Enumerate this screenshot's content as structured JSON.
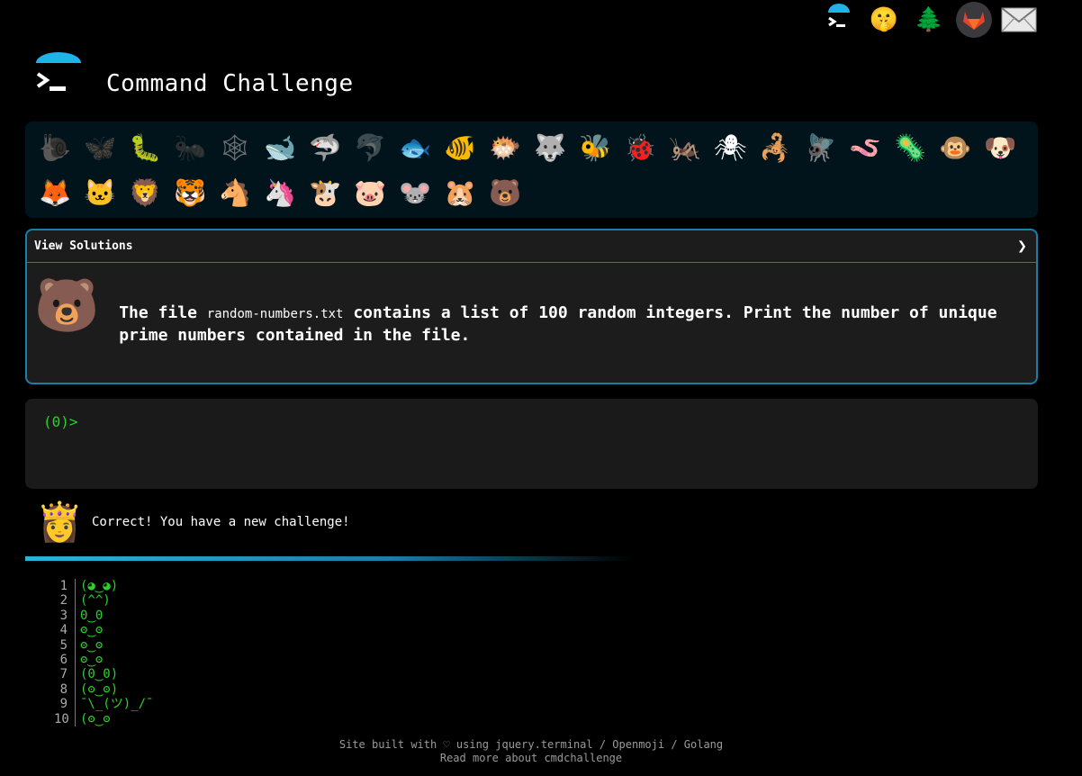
{
  "header": {
    "title": "Command Challenge"
  },
  "top_icons": [
    {
      "name": "cmd-logo-icon",
      "glyph": ""
    },
    {
      "name": "shushing-face-icon",
      "glyph": "🤫"
    },
    {
      "name": "tree-icon",
      "glyph": "🌲"
    },
    {
      "name": "gitlab-icon",
      "glyph": ""
    },
    {
      "name": "mail-icon",
      "glyph": "✉"
    }
  ],
  "animals": [
    {
      "glyph": "🐌",
      "name": "snail",
      "done": false
    },
    {
      "glyph": "🦋",
      "name": "butterfly",
      "done": false
    },
    {
      "glyph": "🐛",
      "name": "caterpillar",
      "done": true
    },
    {
      "glyph": "🐜",
      "name": "ant",
      "done": false
    },
    {
      "glyph": "🕸",
      "name": "spider-web",
      "done": false
    },
    {
      "glyph": "🐋",
      "name": "whale",
      "done": true
    },
    {
      "glyph": "🦈",
      "name": "shark",
      "done": true
    },
    {
      "glyph": "🐬",
      "name": "dolphin",
      "done": false
    },
    {
      "glyph": "🐟",
      "name": "fish",
      "done": true
    },
    {
      "glyph": "🐠",
      "name": "tropical-fish",
      "done": true
    },
    {
      "glyph": "🐡",
      "name": "blowfish",
      "done": true
    },
    {
      "glyph": "🐺",
      "name": "wolf",
      "done": true
    },
    {
      "glyph": "🐝",
      "name": "bee",
      "done": true
    },
    {
      "glyph": "🐞",
      "name": "ladybug",
      "done": true
    },
    {
      "glyph": "🦗",
      "name": "cricket",
      "done": true
    },
    {
      "glyph": "🕷",
      "name": "spider",
      "done": true
    },
    {
      "glyph": "🦂",
      "name": "scorpion",
      "done": true
    },
    {
      "glyph": "🪰",
      "name": "fly",
      "done": true
    },
    {
      "glyph": "🪱",
      "name": "worm",
      "done": true
    },
    {
      "glyph": "🦠",
      "name": "microbe",
      "done": true
    },
    {
      "glyph": "🐵",
      "name": "monkey",
      "done": true
    },
    {
      "glyph": "🐶",
      "name": "dog",
      "done": true
    },
    {
      "glyph": "🦊",
      "name": "fox",
      "done": true
    },
    {
      "glyph": "🐱",
      "name": "cat",
      "done": true
    },
    {
      "glyph": "🦁",
      "name": "lion",
      "done": true
    },
    {
      "glyph": "🐯",
      "name": "tiger",
      "done": true
    },
    {
      "glyph": "🐴",
      "name": "horse",
      "done": true
    },
    {
      "glyph": "🦄",
      "name": "unicorn",
      "done": true
    },
    {
      "glyph": "🐮",
      "name": "cow",
      "done": true
    },
    {
      "glyph": "🐷",
      "name": "pig",
      "done": true
    },
    {
      "glyph": "🐭",
      "name": "mouse",
      "done": true
    },
    {
      "glyph": "🐹",
      "name": "hamster",
      "done": true
    },
    {
      "glyph": "🐻",
      "name": "bear",
      "done": true
    }
  ],
  "solutions": {
    "label": "View Solutions",
    "chevron": "❯",
    "avatar": "🐻",
    "text_before": "The file ",
    "file": "random-numbers.txt",
    "text_after": " contains a list of 100 random integers. Print the number of unique prime numbers contained in the file."
  },
  "terminal": {
    "prompt": "(0)>"
  },
  "result": {
    "avatar": "👸",
    "message": "Correct! You have a new challenge!"
  },
  "progress": {
    "fraction": 0.6
  },
  "faces": [
    {
      "n": "1",
      "code": "(◕‿◕)"
    },
    {
      "n": "2",
      "code": "(^^)"
    },
    {
      "n": "3",
      "code": "0‿0"
    },
    {
      "n": "4",
      "code": "ʘ‿ʘ"
    },
    {
      "n": "5",
      "code": "ʘ‿ʘ"
    },
    {
      "n": "6",
      "code": "ʘ‿ʘ"
    },
    {
      "n": "7",
      "code": "(0‿0)"
    },
    {
      "n": "8",
      "code": "(ʘ‿ʘ)"
    },
    {
      "n": "9",
      "code": "¯\\_(ツ)_/¯"
    },
    {
      "n": "10",
      "code": "(ʘ‿ʘ"
    }
  ],
  "footer": {
    "line1": "Site built with ♡ using jquery.terminal / Openmoji / Golang",
    "line2": "Read more about cmdchallenge"
  },
  "colors": {
    "accent": "#1a7fa6",
    "prompt": "#2ad12a",
    "panel": "#01141c"
  }
}
